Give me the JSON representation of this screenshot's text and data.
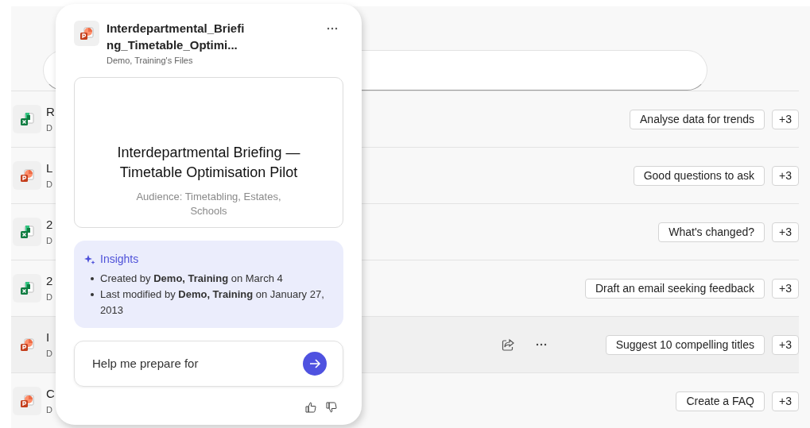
{
  "files": [
    {
      "kind": "excel",
      "name": "R",
      "owner": "D",
      "hovered": false,
      "suggestion": "Analyse data for trends",
      "more": "+3"
    },
    {
      "kind": "powerpoint",
      "name": "L",
      "owner": "D",
      "hovered": false,
      "suggestion": "Good questions to ask",
      "more": "+3"
    },
    {
      "kind": "excel",
      "name": "2",
      "owner": "D",
      "hovered": false,
      "suggestion": "What's changed?",
      "more": "+3"
    },
    {
      "kind": "excel",
      "name": "2",
      "owner": "D",
      "hovered": false,
      "suggestion": "Draft an email seeking feedback",
      "more": "+3"
    },
    {
      "kind": "powerpoint",
      "name": "I",
      "owner": "D",
      "hovered": true,
      "suggestion": "Suggest 10 compelling titles",
      "more": "+3"
    },
    {
      "kind": "powerpoint",
      "name": "C",
      "owner": "D",
      "hovered": false,
      "suggestion": "Create a FAQ",
      "more": "+3"
    }
  ],
  "card": {
    "kind": "powerpoint",
    "title": "Interdepartmental_Briefing_Timetable_Optimi...",
    "location": "Demo, Training's Files",
    "preview": {
      "heading": "Interdepartmental Briefing — Timetable Optimisation Pilot",
      "subtitle": "Audience: Timetabling, Estates, Schools"
    },
    "insights": {
      "title": "Insights",
      "items": [
        "Created by **Demo, Training** on March 4",
        "Last modified by **Demo, Training** on January 27, 2013"
      ]
    },
    "prompt": {
      "value": "Help me prepare for"
    }
  }
}
